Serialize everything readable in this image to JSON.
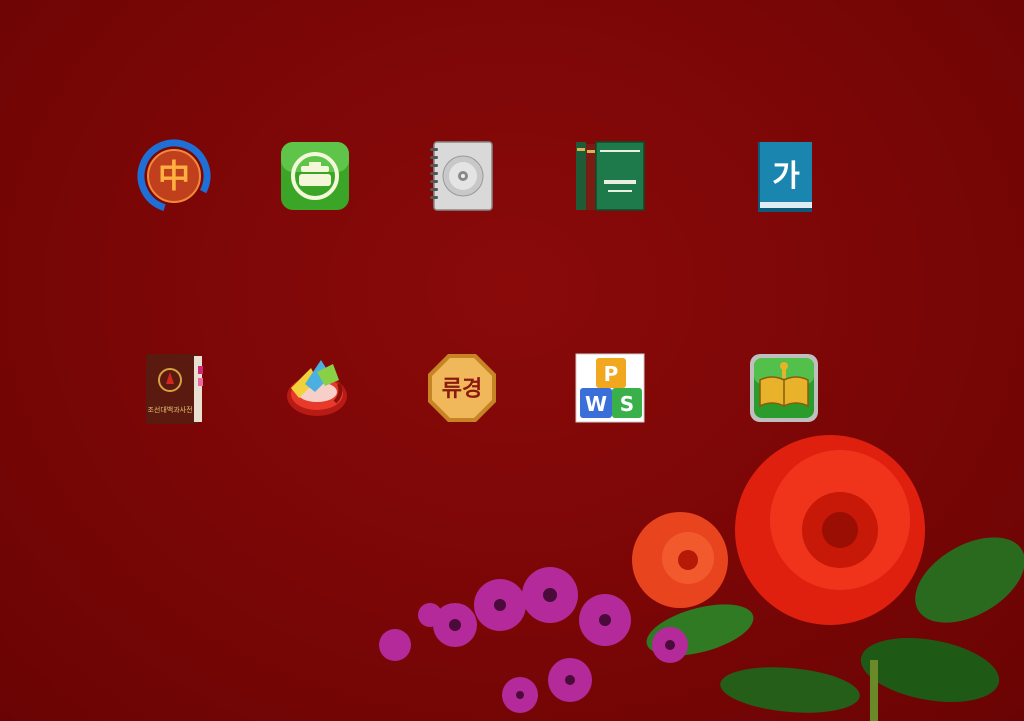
{
  "desktop": {
    "background_color": "#7a0606",
    "icons": [
      {
        "id": "zhong",
        "icon": "chinese-zhong-icon",
        "glyph": "中",
        "accent": "#1e6fd6"
      },
      {
        "id": "cooker",
        "icon": "rice-cooker-icon",
        "accent": "#3aa526"
      },
      {
        "id": "disc",
        "icon": "cd-notebook-icon",
        "accent": "#c0c0c0"
      },
      {
        "id": "books",
        "icon": "bookshelf-icon",
        "accent": "#1e7a4a"
      },
      {
        "id": "ga",
        "icon": "hangul-ga-book-icon",
        "glyph": "가",
        "accent": "#1a86b0"
      },
      {
        "id": "dictionary",
        "icon": "red-book-icon",
        "glyph": "조선대백과사전",
        "accent": "#5a1a10"
      },
      {
        "id": "slides",
        "icon": "presentation-icon",
        "accent": "#d8281e"
      },
      {
        "id": "ryugyong",
        "icon": "ryugyong-badge-icon",
        "glyph": "류경",
        "accent": "#e7a84a"
      },
      {
        "id": "pws",
        "icon": "pws-office-icon",
        "glyph_p": "P",
        "glyph_w": "W",
        "glyph_s": "S",
        "accent": "#f2a81e"
      },
      {
        "id": "library",
        "icon": "open-book-library-icon",
        "accent": "#2b9c2b"
      }
    ]
  }
}
